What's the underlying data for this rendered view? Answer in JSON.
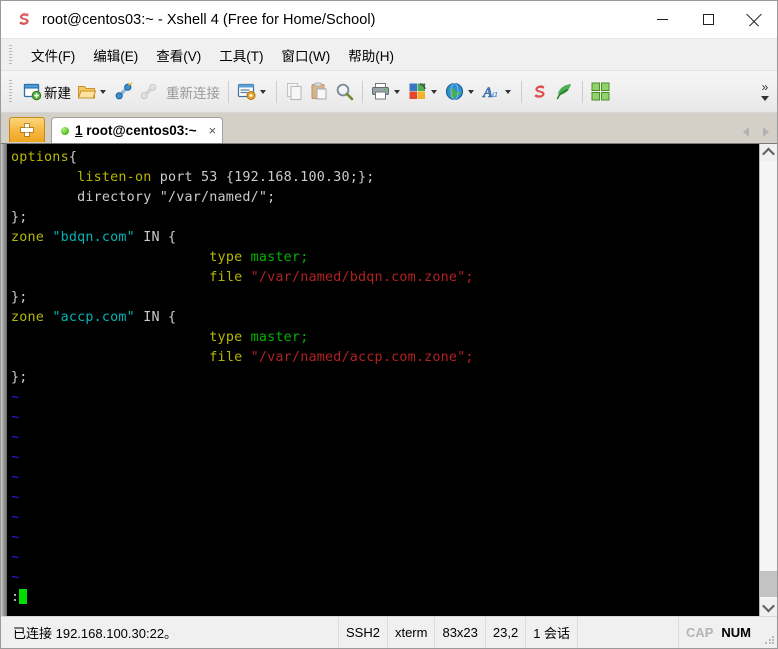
{
  "window": {
    "title": "root@centos03:~ - Xshell 4 (Free for Home/School)",
    "app_icon": "xshell-logo-icon",
    "controls": {
      "minimize": "minimize-button",
      "maximize": "maximize-button",
      "close": "close-button"
    }
  },
  "menubar": {
    "items": [
      {
        "label": "文件(F)"
      },
      {
        "label": "编辑(E)"
      },
      {
        "label": "查看(V)"
      },
      {
        "label": "工具(T)"
      },
      {
        "label": "窗口(W)"
      },
      {
        "label": "帮助(H)"
      }
    ]
  },
  "toolbar": {
    "new_label": "新建",
    "reconnect_label": "重新连接",
    "overflow_label": "»",
    "buttons": [
      {
        "name": "new-session",
        "icon": "new-window-icon",
        "label": "新建"
      },
      {
        "name": "open-folder",
        "icon": "open-folder-icon",
        "label": "",
        "caret": true
      },
      {
        "name": "connect",
        "icon": "connect-plug-icon",
        "label": ""
      },
      {
        "name": "disconnect",
        "icon": "disconnect-plug-icon",
        "label": ""
      },
      {
        "name": "reconnect",
        "icon": "reconnect-icon",
        "label": "重新连接"
      },
      {
        "name": "session-properties",
        "icon": "properties-icon",
        "label": "",
        "caret": true
      },
      {
        "name": "copy",
        "icon": "copy-icon",
        "label": ""
      },
      {
        "name": "paste",
        "icon": "paste-icon",
        "label": ""
      },
      {
        "name": "find",
        "icon": "search-icon",
        "label": ""
      },
      {
        "name": "print",
        "icon": "printer-icon",
        "label": "",
        "caret": true
      },
      {
        "name": "layout",
        "icon": "layout-color-icon",
        "label": "",
        "caret": true
      },
      {
        "name": "web-browser",
        "icon": "globe-icon",
        "label": "",
        "caret": true
      },
      {
        "name": "font",
        "icon": "font-a-icon",
        "label": "",
        "caret": true
      },
      {
        "name": "xshell",
        "icon": "xshell-icon",
        "label": ""
      },
      {
        "name": "xftp",
        "icon": "xftp-icon",
        "label": ""
      },
      {
        "name": "arrange",
        "icon": "tile-grid-icon",
        "label": ""
      }
    ]
  },
  "tabbar": {
    "new_tab_icon": "plus-icon",
    "tabs": [
      {
        "index": "1",
        "title": "root@centos03:~",
        "status": "connected",
        "close_icon": "×"
      }
    ],
    "nav_prev": "tab-prev-icon",
    "nav_next": "tab-next-icon"
  },
  "terminal": {
    "lines": [
      [
        {
          "t": "options",
          "c": "yellow"
        },
        {
          "t": "{",
          "c": "white"
        }
      ],
      [
        {
          "t": "        ",
          "c": "white"
        },
        {
          "t": "listen-on",
          "c": "yellow"
        },
        {
          "t": " port 53 {192.168.100.30;};",
          "c": "white"
        }
      ],
      [
        {
          "t": "        directory \"/var/named/\";",
          "c": "white"
        }
      ],
      [
        {
          "t": "};",
          "c": "white"
        }
      ],
      [
        {
          "t": "zone",
          "c": "yellow"
        },
        {
          "t": " ",
          "c": "white"
        },
        {
          "t": "\"bdqn.com\"",
          "c": "cyan"
        },
        {
          "t": " IN {",
          "c": "white"
        }
      ],
      [
        {
          "t": "                        ",
          "c": "white"
        },
        {
          "t": "type",
          "c": "yellow"
        },
        {
          "t": " ",
          "c": "white"
        },
        {
          "t": "master;",
          "c": "green"
        }
      ],
      [
        {
          "t": "                        ",
          "c": "white"
        },
        {
          "t": "file",
          "c": "yellow"
        },
        {
          "t": " ",
          "c": "white"
        },
        {
          "t": "\"/var/named/bdqn.com.zone\";",
          "c": "red"
        }
      ],
      [
        {
          "t": "};",
          "c": "white"
        }
      ],
      [
        {
          "t": "zone",
          "c": "yellow"
        },
        {
          "t": " ",
          "c": "white"
        },
        {
          "t": "\"accp.com\"",
          "c": "cyan"
        },
        {
          "t": " IN {",
          "c": "white"
        }
      ],
      [
        {
          "t": "                        ",
          "c": "white"
        },
        {
          "t": "type",
          "c": "yellow"
        },
        {
          "t": " ",
          "c": "white"
        },
        {
          "t": "master;",
          "c": "green"
        }
      ],
      [
        {
          "t": "                        ",
          "c": "white"
        },
        {
          "t": "file",
          "c": "yellow"
        },
        {
          "t": " ",
          "c": "white"
        },
        {
          "t": "\"/var/named/accp.com.zone\";",
          "c": "red"
        }
      ],
      [
        {
          "t": "};",
          "c": "white"
        }
      ],
      [
        {
          "t": "~",
          "c": "blue"
        }
      ],
      [
        {
          "t": "~",
          "c": "blue"
        }
      ],
      [
        {
          "t": "~",
          "c": "blue"
        }
      ],
      [
        {
          "t": "~",
          "c": "blue"
        }
      ],
      [
        {
          "t": "~",
          "c": "blue"
        }
      ],
      [
        {
          "t": "~",
          "c": "blue"
        }
      ],
      [
        {
          "t": "~",
          "c": "blue"
        }
      ],
      [
        {
          "t": "~",
          "c": "blue"
        }
      ],
      [
        {
          "t": "~",
          "c": "blue"
        }
      ],
      [
        {
          "t": "~",
          "c": "blue"
        }
      ],
      [
        {
          "t": ":",
          "c": "white"
        },
        {
          "t": "CURSOR",
          "c": "cursor"
        }
      ]
    ],
    "colors": {
      "background": "#000000",
      "foreground": "#cccccc",
      "keyword": "#b7b700",
      "string_cyan": "#00b3b3",
      "string_red": "#b22020",
      "value_green": "#00b300",
      "tilde_blue": "#2424e0",
      "cursor": "#00dd00"
    },
    "scrollbar": {
      "up_icon": "scroll-up-icon",
      "down_icon": "scroll-down-icon"
    }
  },
  "statusbar": {
    "connection": "已连接 192.168.100.30:22。",
    "protocol": "SSH2",
    "term_type": "xterm",
    "size": "83x23",
    "cursor_pos": "23,2",
    "sessions": "1 会话",
    "cap": "CAP",
    "num": "NUM",
    "grip": "resize-grip-icon"
  }
}
